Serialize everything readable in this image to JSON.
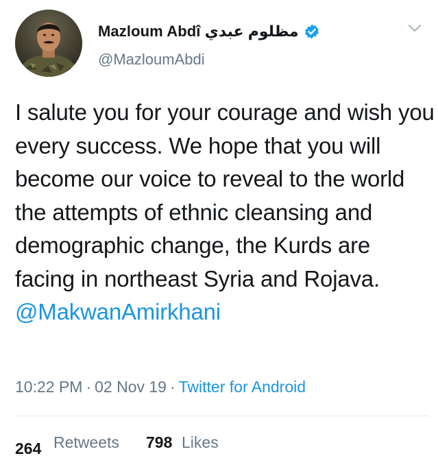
{
  "author": {
    "display_name": "Mazloum Abdî مظلوم عبدي",
    "handle": "@MazloumAbdi",
    "verified_icon": "verified-badge-icon",
    "avatar_icon": "profile-avatar"
  },
  "tweet": {
    "text": "I salute you for your courage and wish you every success. We hope that you will become our voice to reveal to the world the attempts of ethnic cleansing and demographic change, the Kurds are facing in northeast Syria and Rojava.",
    "mention": "@MakwanAmirkhani",
    "time": "10:22 PM",
    "separator": "·",
    "date": "02 Nov 19",
    "source": "Twitter for Android"
  },
  "stats": {
    "retweets_count": "264",
    "retweets_label": "Retweets",
    "likes_count": "798",
    "likes_label": "Likes"
  },
  "colors": {
    "link": "#1b95e0",
    "secondary_text": "#657786",
    "primary_text": "#14171a",
    "verified": "#1da1f2",
    "divider": "#e1e8ed"
  },
  "icons": {
    "menu": "chevron-down-icon",
    "verified": "verified-badge-icon"
  }
}
